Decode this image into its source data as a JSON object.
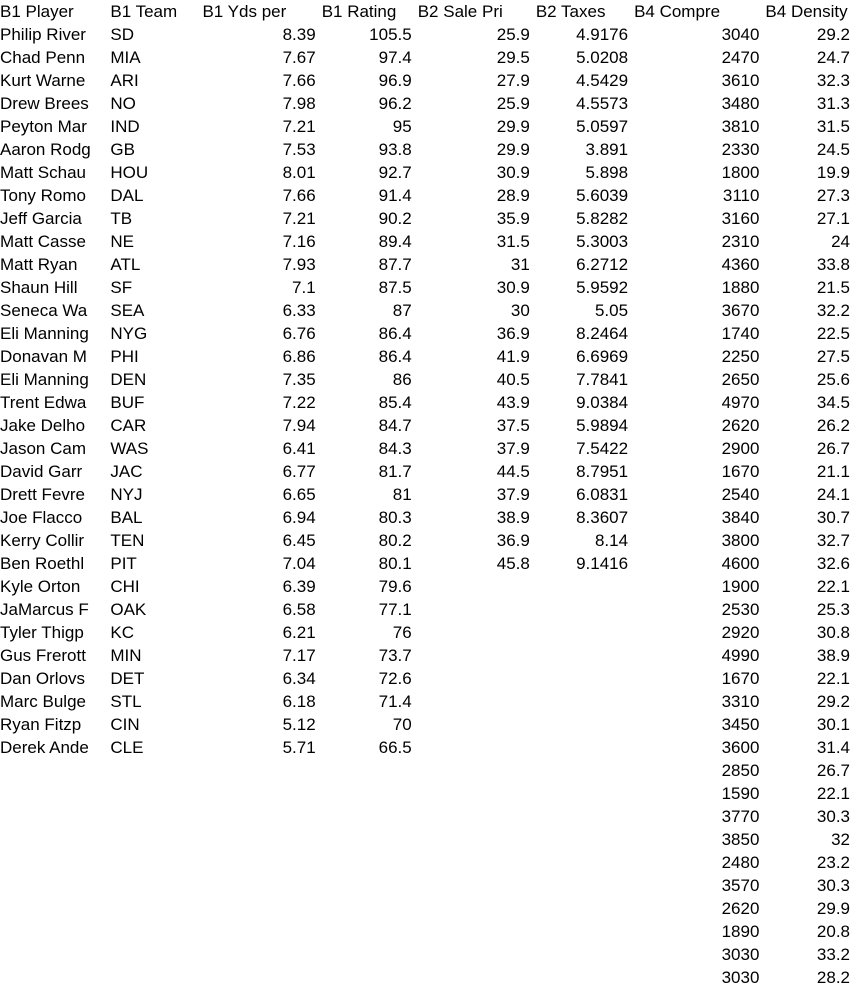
{
  "table": {
    "headers": [
      "B1 Player",
      "B1 Team",
      "B1 Yds per",
      "B1 Rating",
      "B2 Sale Pri",
      "B2 Taxes",
      "B4 Compre",
      "B4 Density"
    ],
    "columns": {
      "player": [
        "Philip River",
        "Chad Penn",
        "Kurt Warne",
        "Drew Brees",
        "Peyton Mar",
        "Aaron Rodg",
        "Matt Schau",
        "Tony Romo",
        "Jeff Garcia",
        "Matt Casse",
        "Matt Ryan",
        "Shaun Hill",
        "Seneca Wa",
        "Eli Manning",
        "Donavan M",
        "Eli Manning",
        "Trent Edwa",
        "Jake Delho",
        "Jason Cam",
        "David Garr",
        "Drett Fevre",
        "Joe Flacco",
        "Kerry Collir",
        "Ben Roethl",
        "Kyle Orton",
        "JaMarcus F",
        "Tyler Thigp",
        "Gus Frerott",
        "Dan Orlovs",
        "Marc Bulge",
        "Ryan Fitzp",
        "Derek Ande"
      ],
      "team": [
        "SD",
        "MIA",
        "ARI",
        "NO",
        "IND",
        "GB",
        "HOU",
        "DAL",
        "TB",
        "NE",
        "ATL",
        "SF",
        "SEA",
        "NYG",
        "PHI",
        "DEN",
        "BUF",
        "CAR",
        "WAS",
        "JAC",
        "NYJ",
        "BAL",
        "TEN",
        "PIT",
        "CHI",
        "OAK",
        "KC",
        "MIN",
        "DET",
        "STL",
        "CIN",
        "CLE"
      ],
      "yds_per": [
        "8.39",
        "7.67",
        "7.66",
        "7.98",
        "7.21",
        "7.53",
        "8.01",
        "7.66",
        "7.21",
        "7.16",
        "7.93",
        "7.1",
        "6.33",
        "6.76",
        "6.86",
        "7.35",
        "7.22",
        "7.94",
        "6.41",
        "6.77",
        "6.65",
        "6.94",
        "6.45",
        "7.04",
        "6.39",
        "6.58",
        "6.21",
        "7.17",
        "6.34",
        "6.18",
        "5.12",
        "5.71"
      ],
      "rating": [
        "105.5",
        "97.4",
        "96.9",
        "96.2",
        "95",
        "93.8",
        "92.7",
        "91.4",
        "90.2",
        "89.4",
        "87.7",
        "87.5",
        "87",
        "86.4",
        "86.4",
        "86",
        "85.4",
        "84.7",
        "84.3",
        "81.7",
        "81",
        "80.3",
        "80.2",
        "80.1",
        "79.6",
        "77.1",
        "76",
        "73.7",
        "72.6",
        "71.4",
        "70",
        "66.5"
      ],
      "sale_price": [
        "25.9",
        "29.5",
        "27.9",
        "25.9",
        "29.9",
        "29.9",
        "30.9",
        "28.9",
        "35.9",
        "31.5",
        "31",
        "30.9",
        "30",
        "36.9",
        "41.9",
        "40.5",
        "43.9",
        "37.5",
        "37.9",
        "44.5",
        "37.9",
        "38.9",
        "36.9",
        "45.8"
      ],
      "taxes": [
        "4.9176",
        "5.0208",
        "4.5429",
        "4.5573",
        "5.0597",
        "3.891",
        "5.898",
        "5.6039",
        "5.8282",
        "5.3003",
        "6.2712",
        "5.9592",
        "5.05",
        "8.2464",
        "6.6969",
        "7.7841",
        "9.0384",
        "5.9894",
        "7.5422",
        "8.7951",
        "6.0831",
        "8.3607",
        "8.14",
        "9.1416"
      ],
      "compressive": [
        "3040",
        "2470",
        "3610",
        "3480",
        "3810",
        "2330",
        "1800",
        "3110",
        "3160",
        "2310",
        "4360",
        "1880",
        "3670",
        "1740",
        "2250",
        "2650",
        "4970",
        "2620",
        "2900",
        "1670",
        "2540",
        "3840",
        "3800",
        "4600",
        "1900",
        "2530",
        "2920",
        "4990",
        "1670",
        "3310",
        "3450",
        "3600",
        "2850",
        "1590",
        "3770",
        "3850",
        "2480",
        "3570",
        "2620",
        "1890",
        "3030",
        "3030"
      ],
      "density": [
        "29.2",
        "24.7",
        "32.3",
        "31.3",
        "31.5",
        "24.5",
        "19.9",
        "27.3",
        "27.1",
        "24",
        "33.8",
        "21.5",
        "32.2",
        "22.5",
        "27.5",
        "25.6",
        "34.5",
        "26.2",
        "26.7",
        "21.1",
        "24.1",
        "30.7",
        "32.7",
        "32.6",
        "22.1",
        "25.3",
        "30.8",
        "38.9",
        "22.1",
        "29.2",
        "30.1",
        "31.4",
        "26.7",
        "22.1",
        "30.3",
        "32",
        "23.2",
        "30.3",
        "29.9",
        "20.8",
        "33.2",
        "28.2"
      ]
    }
  }
}
